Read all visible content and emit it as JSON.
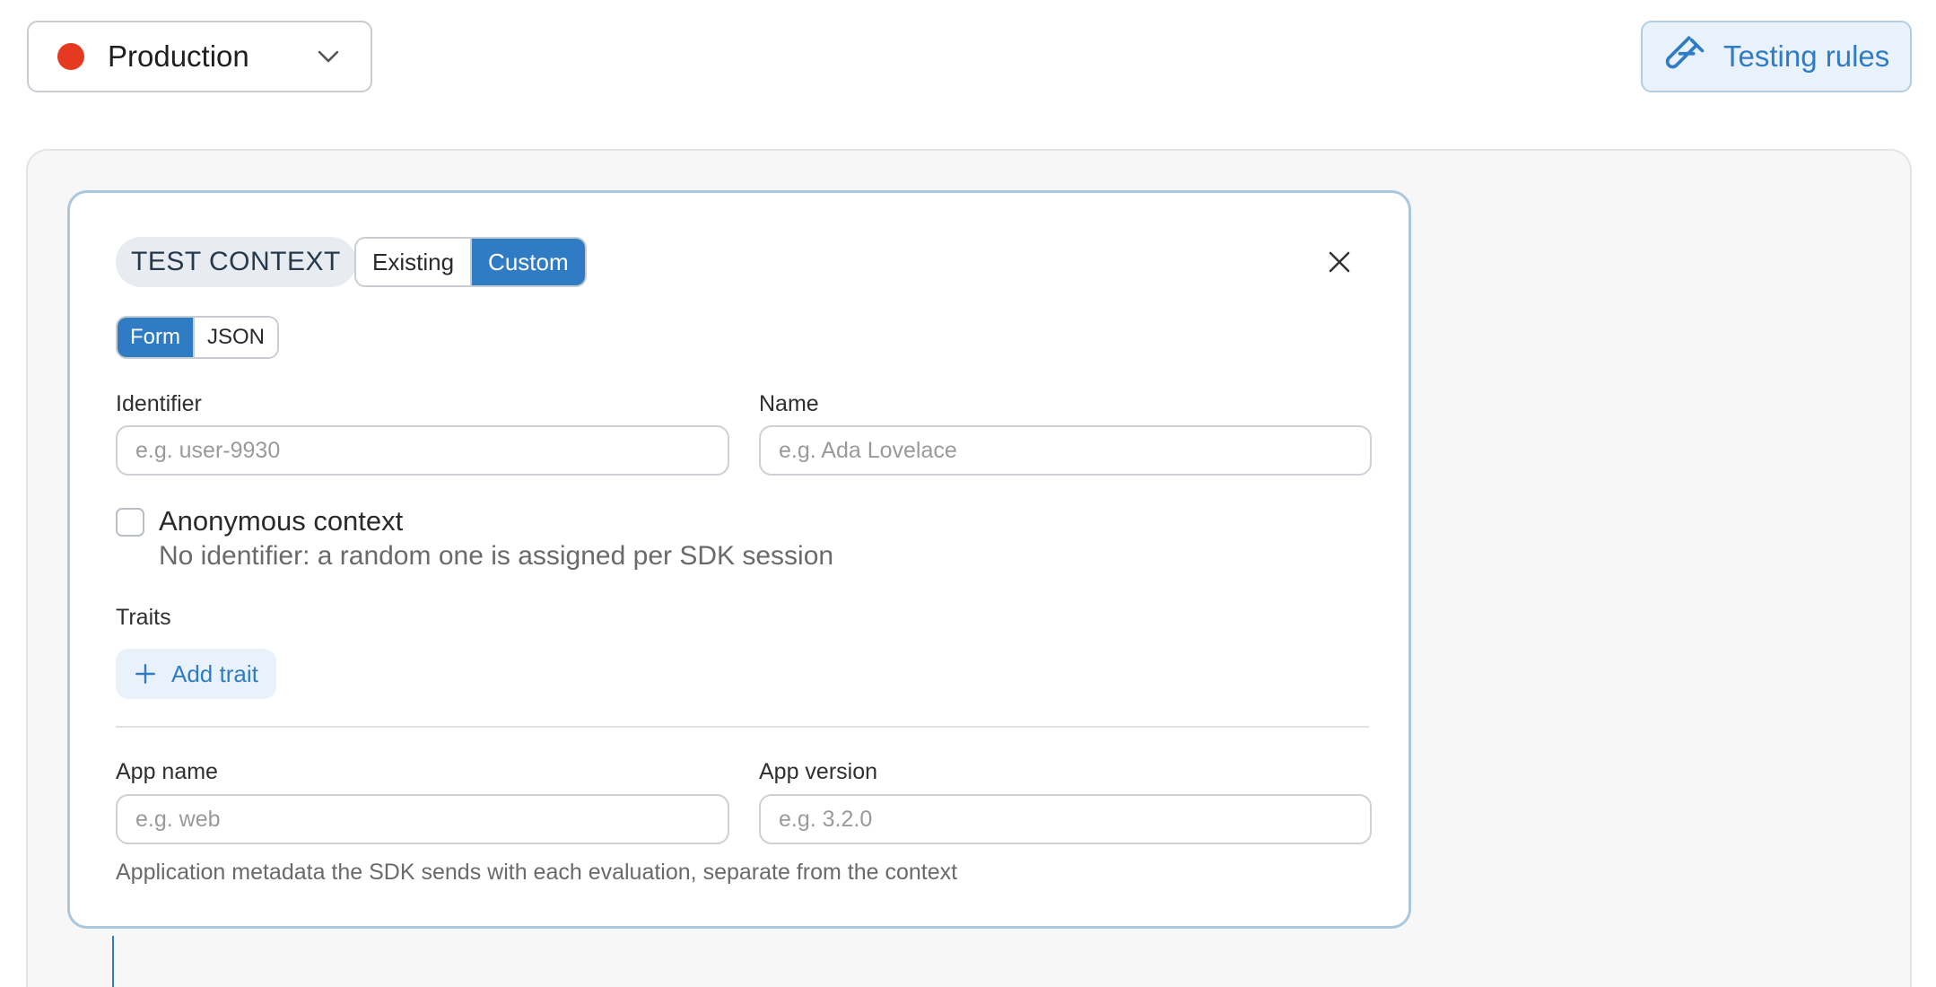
{
  "environment": {
    "label": "Production",
    "status_color": "#e53a1f",
    "icon": "chevron-down-icon"
  },
  "testing_button": {
    "label": "Testing rules",
    "icon": "test-tube-icon"
  },
  "test_context": {
    "badge": "TEST CONTEXT",
    "source_tabs": [
      {
        "label": "Existing",
        "active": false
      },
      {
        "label": "Custom",
        "active": true
      }
    ],
    "mode_tabs": [
      {
        "label": "Form",
        "active": true
      },
      {
        "label": "JSON",
        "active": false
      }
    ],
    "identifier": {
      "label": "Identifier",
      "value": "",
      "placeholder": "e.g. user-9930"
    },
    "name": {
      "label": "Name",
      "value": "",
      "placeholder": "e.g. Ada Lovelace"
    },
    "anonymous": {
      "label": "Anonymous context",
      "help": "No identifier: a random one is assigned per SDK session",
      "checked": false
    },
    "traits": {
      "label": "Traits",
      "add_label": "Add trait"
    },
    "app_name": {
      "label": "App name",
      "value": "",
      "placeholder": "e.g. web"
    },
    "app_version": {
      "label": "App version",
      "value": "",
      "placeholder": "e.g. 3.2.0"
    },
    "app_help": "Application metadata the SDK sends with each evaluation, separate from the context"
  },
  "colors": {
    "accent": "#2f7cc4",
    "accent_bg": "#e9f2fb",
    "card_border": "#a9c8e0"
  }
}
